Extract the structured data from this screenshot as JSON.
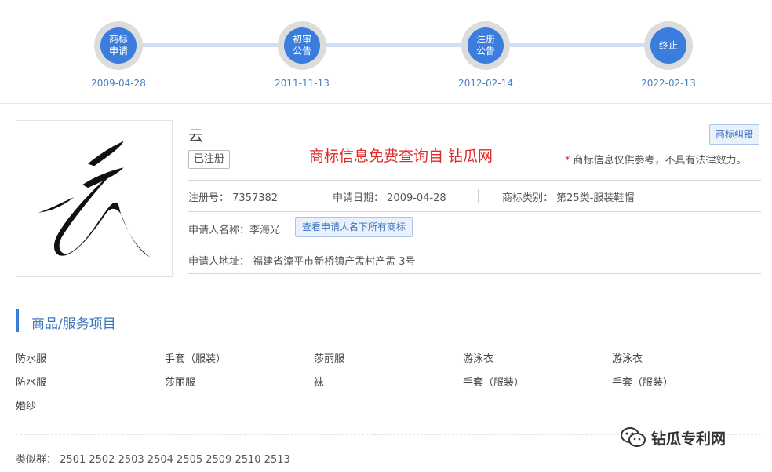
{
  "timeline": [
    {
      "label": "商标申请",
      "date": "2009-04-28"
    },
    {
      "label": "初审公告",
      "date": "2011-11-13"
    },
    {
      "label": "注册公告",
      "date": "2012-02-14"
    },
    {
      "label": "终止",
      "date": "2022-02-13"
    }
  ],
  "trademark": {
    "name": "云",
    "status": "已注册",
    "promo": "商标信息免费查询自 钻瓜网",
    "correct_button": "商标纠错",
    "disclaimer": "商标信息仅供参考，不具有法律效力。",
    "disclaimer_star": "*",
    "reg_no_label": "注册号：",
    "reg_no": "7357382",
    "apply_date_label": "申请日期：",
    "apply_date": "2009-04-28",
    "category_label": "商标类别：",
    "category": "第25类-服装鞋帽",
    "applicant_label": "申请人名称：",
    "applicant": "李海光",
    "view_all_button": "查看申请人名下所有商标",
    "address_label": "申请人地址：",
    "address": "福建省漳平市新桥镇产盂村产盂 3号"
  },
  "goods": {
    "title": "商品/服务项目",
    "items": [
      "防水服",
      "手套（服装）",
      "莎丽服",
      "游泳衣",
      "游泳衣",
      "防水服",
      "莎丽服",
      "袜",
      "手套（服装）",
      "手套（服装）",
      "婚纱"
    ],
    "similar_label": "类似群：",
    "similar_groups": "2501 2502 2503 2504 2505 2509 2510 2513"
  },
  "watermark": {
    "text": "钻瓜专利网",
    "icon": "wechat-icon"
  }
}
